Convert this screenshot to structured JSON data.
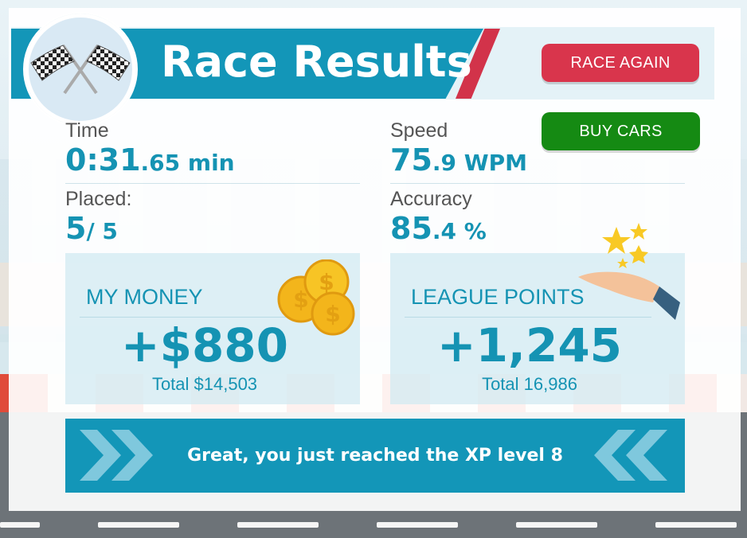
{
  "header": {
    "title": "Race Results"
  },
  "buttons": {
    "race_again": "RACE AGAIN",
    "buy_cars": "BUY CARS"
  },
  "stats": {
    "time": {
      "label": "Time",
      "main": "0:31",
      "decimal": ".65",
      "unit": " min"
    },
    "speed": {
      "label": "Speed",
      "main": "75",
      "decimal": ".9",
      "unit": " WPM"
    },
    "placed": {
      "label": "Placed:",
      "main": "5",
      "rest": "/ 5"
    },
    "accuracy": {
      "label": "Accuracy",
      "main": "85",
      "decimal": ".4",
      "unit": " %"
    }
  },
  "money": {
    "title": "MY MONEY",
    "amount": "+$880",
    "total": "Total $14,503"
  },
  "league": {
    "title": "LEAGUE POINTS",
    "amount": "+1,245",
    "total": "Total 16,986"
  },
  "xp": {
    "message": "Great, you just reached the XP level 8"
  },
  "colors": {
    "accent": "#1396b8",
    "red": "#d9354c",
    "green": "#158a13",
    "stripe": "#d2334a"
  },
  "icons": [
    "checkered-flags-icon",
    "gold-coins-icon",
    "hand-with-stars-icon",
    "chevron-right-icon",
    "chevron-left-icon"
  ]
}
